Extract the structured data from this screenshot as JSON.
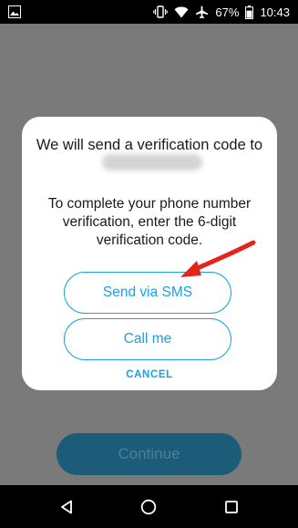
{
  "status": {
    "battery": "67%",
    "time": "10:43"
  },
  "dialog": {
    "title": "We will send a verification code to",
    "body": "To complete your phone number verification, enter the 6-digit verification code.",
    "sms_label": "Send via SMS",
    "call_label": "Call me",
    "cancel_label": "CANCEL"
  },
  "continue_label": "Continue",
  "colors": {
    "accent": "#1ba1e2",
    "continue_bg": "#1c5c79",
    "overlay": "#7a7a7a",
    "annotation_arrow": "#e5231b"
  }
}
